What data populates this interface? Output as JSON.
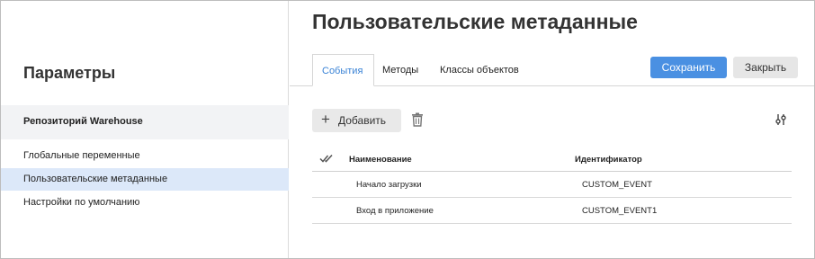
{
  "page": {
    "title": "Пользовательские метаданные"
  },
  "sidebar": {
    "title": "Параметры",
    "repository": "Репозиторий Warehouse",
    "items": [
      {
        "label": "Глобальные переменные",
        "active": false
      },
      {
        "label": "Пользовательские метаданные",
        "active": true
      },
      {
        "label": "Настройки по умолчанию",
        "active": false
      }
    ]
  },
  "tabs": [
    {
      "label": "События",
      "active": true
    },
    {
      "label": "Методы",
      "active": false
    },
    {
      "label": "Классы объектов",
      "active": false
    }
  ],
  "header_actions": {
    "save_label": "Сохранить",
    "close_label": "Закрыть"
  },
  "toolbar": {
    "add_label": "Добавить",
    "add_icon": "plus-icon",
    "delete_icon": "trash-icon",
    "settings_icon": "filter-sliders-icon"
  },
  "table": {
    "columns": [
      "Наименование",
      "Идентификатор"
    ],
    "rows": [
      {
        "name": "Начало загрузки",
        "id": "CUSTOM_EVENT"
      },
      {
        "name": "Вход в приложение",
        "id": "CUSTOM_EVENT1"
      }
    ]
  },
  "colors": {
    "accent": "#4a90e2",
    "active_nav": "#dce8f9",
    "tab_active_text": "#3a83d6"
  }
}
